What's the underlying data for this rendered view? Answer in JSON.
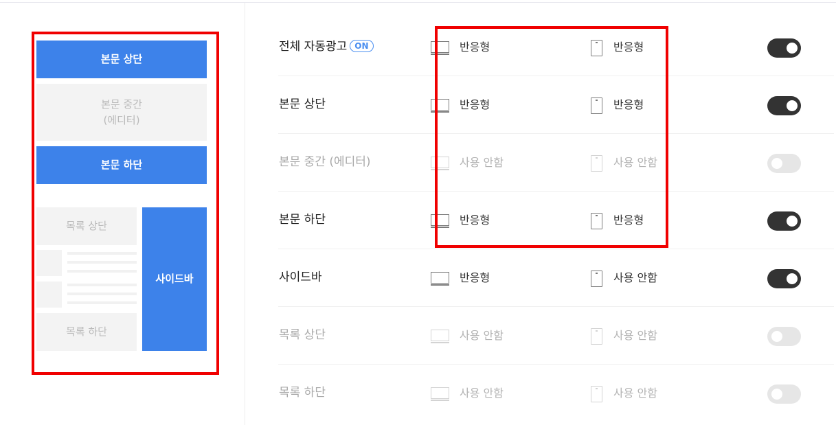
{
  "preview": {
    "body_top": "본문 상단",
    "body_middle_line1": "본문 중간",
    "body_middle_line2": "(에디터)",
    "body_bottom": "본문 하단",
    "list_top": "목록 상단",
    "list_bottom": "목록 하단",
    "sidebar": "사이드바"
  },
  "rows": [
    {
      "label": "전체 자동광고",
      "badge": "ON",
      "pc": "반응형",
      "mobile": "반응형",
      "enabled": true
    },
    {
      "label": "본문 상단",
      "pc": "반응형",
      "mobile": "반응형",
      "enabled": true
    },
    {
      "label": "본문 중간 (에디터)",
      "pc": "사용 안함",
      "mobile": "사용 안함",
      "enabled": false
    },
    {
      "label": "본문 하단",
      "pc": "반응형",
      "mobile": "반응형",
      "enabled": true
    },
    {
      "label": "사이드바",
      "pc": "반응형",
      "mobile": "사용 안함",
      "enabled": true
    },
    {
      "label": "목록 상단",
      "pc": "사용 안함",
      "mobile": "사용 안함",
      "enabled": false
    },
    {
      "label": "목록 하단",
      "pc": "사용 안함",
      "mobile": "사용 안함",
      "enabled": false
    }
  ],
  "icons": {
    "pc": "monitor-icon",
    "mobile": "smartphone-icon"
  },
  "colors": {
    "accent": "#3d82ea",
    "highlight": "#f00000",
    "toggle_on": "#333333",
    "toggle_off": "#e6e6e6"
  }
}
